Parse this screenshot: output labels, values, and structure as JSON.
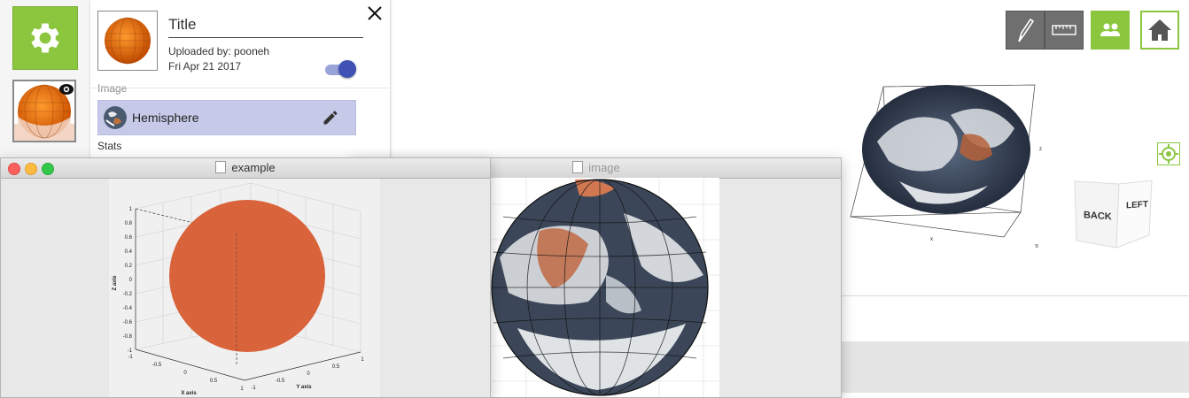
{
  "panel": {
    "title": "Title",
    "uploaded_by": "Uploaded by: pooneh",
    "date": "Fri Apr 21 2017",
    "image_section_label": "Image",
    "image_name": "Hemisphere",
    "stats_label": "Stats",
    "toggle_on": true
  },
  "windows": {
    "example_title": "example",
    "image_title": "image"
  },
  "plot": {
    "x_label": "X axis",
    "y_label": "Y axis",
    "z_label": "Z axis",
    "z_ticks": [
      "1",
      "0.8",
      "0.6",
      "0.4",
      "0.2",
      "0",
      "-0.2",
      "-0.4",
      "-0.6",
      "-0.8",
      "-1"
    ],
    "x_ticks": [
      "-1",
      "-0.5",
      "0",
      "0.5",
      "1"
    ],
    "y_ticks": [
      "-1",
      "-0.5",
      "0",
      "0.5",
      "1"
    ]
  },
  "view_cube": {
    "face_front": "BACK",
    "face_side": "LEFT"
  },
  "colors": {
    "accent_green": "#8cc63f",
    "toggle_blue": "#3f51b5",
    "sphere_orange": "#d9633a",
    "selected_row": "#c6cae8"
  },
  "icons": {
    "settings": "gear-icon",
    "close": "close-icon",
    "edit": "pencil-icon",
    "pen": "pen-icon",
    "ruler": "ruler-icon",
    "users": "users-icon",
    "home": "home-icon",
    "locate": "target-icon",
    "eye": "eye-icon"
  }
}
